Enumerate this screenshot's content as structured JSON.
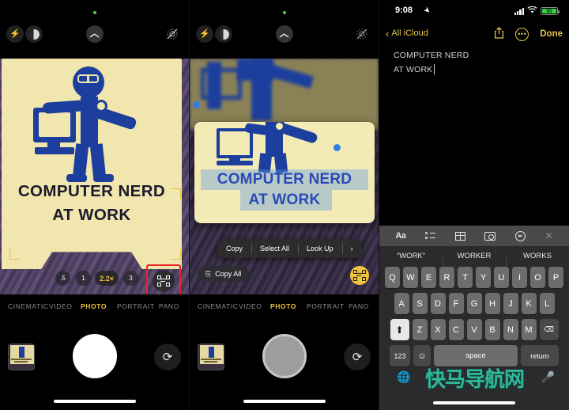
{
  "panel_camera": {
    "top_controls": {
      "flash": "flash-icon",
      "night_mode": "night-mode-icon",
      "chevron": "chevron-up-icon",
      "live_photo": "live-photo-off-icon"
    },
    "sign": {
      "line1": "COMPUTER NERD",
      "line2": "AT WORK"
    },
    "zoom_levels": [
      {
        "label": ".5",
        "selected": false
      },
      {
        "label": "1",
        "selected": false
      },
      {
        "label": "2.2×",
        "selected": true
      },
      {
        "label": "3",
        "selected": false
      }
    ],
    "scan_button": "live-text-scan-button",
    "modes": [
      {
        "label": "CINEMATIC",
        "active": false
      },
      {
        "label": "VIDEO",
        "active": false
      },
      {
        "label": "PHOTO",
        "active": true
      },
      {
        "label": "PORTRAIT",
        "active": false
      },
      {
        "label": "PANO",
        "active": false
      }
    ],
    "shutter": "shutter-button",
    "flip": "flip-camera-button",
    "thumbnail": "last-photo-thumbnail"
  },
  "panel_livetext": {
    "selected_text_line1": "COMPUTER NERD",
    "selected_text_line2": "AT WORK",
    "context_menu": [
      {
        "label": "Copy"
      },
      {
        "label": "Select All"
      },
      {
        "label": "Look Up"
      },
      {
        "label": "›"
      }
    ],
    "copy_all_label": "Copy All",
    "live_text_toggle": "live-text-active-button",
    "modes": [
      {
        "label": "CINEMATIC",
        "active": false
      },
      {
        "label": "VIDEO",
        "active": false
      },
      {
        "label": "PHOTO",
        "active": true
      },
      {
        "label": "PORTRAIT",
        "active": false
      },
      {
        "label": "PANO",
        "active": false
      }
    ]
  },
  "panel_notes": {
    "status_bar": {
      "time": "9:08",
      "location_icon": "location-arrow-icon",
      "signal_icon": "cellular-signal-icon",
      "wifi_icon": "wifi-icon",
      "battery_percent": "95"
    },
    "nav": {
      "back_label": "All iCloud",
      "share_icon": "share-icon",
      "more_icon": "more-ellipsis-icon",
      "done_label": "Done"
    },
    "note": {
      "line1": "COMPUTER NERD",
      "line2": "AT WORK"
    },
    "keyboard": {
      "toolbar": [
        {
          "name": "format-aa-icon",
          "glyph": "Aa"
        },
        {
          "name": "checklist-icon",
          "glyph": ""
        },
        {
          "name": "table-icon",
          "glyph": ""
        },
        {
          "name": "camera-icon",
          "glyph": ""
        },
        {
          "name": "markup-pen-icon",
          "glyph": ""
        },
        {
          "name": "close-icon",
          "glyph": "✕"
        }
      ],
      "suggestions": [
        "“WORK”",
        "WORKER",
        "WORKS"
      ],
      "row1": [
        "Q",
        "W",
        "E",
        "R",
        "T",
        "Y",
        "U",
        "I",
        "O",
        "P"
      ],
      "row2": [
        "A",
        "S",
        "D",
        "F",
        "G",
        "H",
        "J",
        "K",
        "L"
      ],
      "row3": [
        "Z",
        "X",
        "C",
        "V",
        "B",
        "N",
        "M"
      ],
      "shift_label": "⬆",
      "backspace_label": "⌫",
      "numbers_label": "123",
      "emoji_label": "☺",
      "space_label": "space",
      "return_label": "return",
      "globe_icon": "globe-icon",
      "mic_icon": "microphone-icon"
    }
  },
  "watermark": "快马导航网",
  "colors": {
    "accent_yellow": "#f2c23a",
    "notes_yellow": "#e6c44a",
    "sign_bg": "#f0e6ae",
    "figure_blue": "#1c3f9e",
    "battery_green": "#3ad24a",
    "highlight_red": "#e8242a",
    "watermark_teal": "#2fb89a"
  }
}
